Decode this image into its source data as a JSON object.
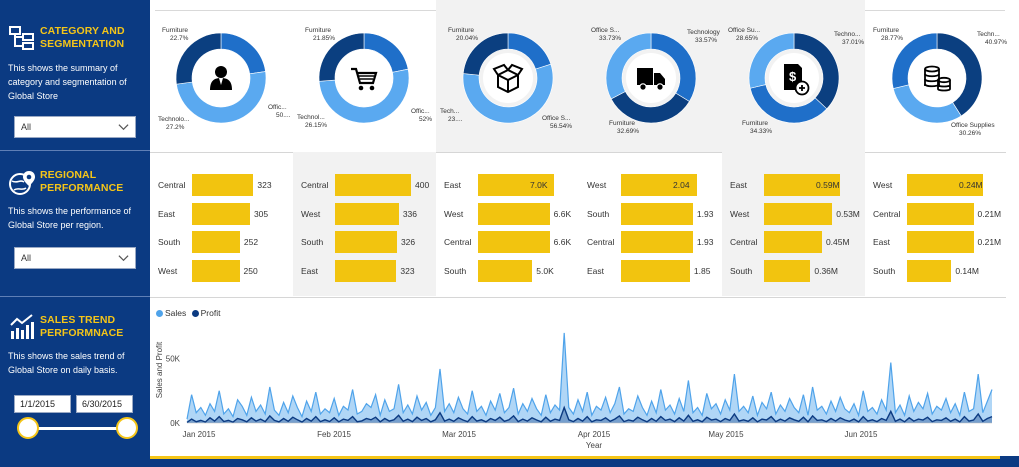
{
  "sidebar": {
    "category": {
      "title_line1": "CATEGORY AND",
      "title_line2": "SEGMENTATION",
      "desc": "This shows the summary of category and segmentation of Global Store",
      "dropdown": "All"
    },
    "regional": {
      "title_line1": "REGIONAL",
      "title_line2": "PERFORMANCE",
      "desc": "This shows the performance of Global Store per region.",
      "dropdown": "All"
    },
    "trend": {
      "title_line1": "SALES TREND",
      "title_line2": "PERFORMNACE",
      "desc": "This shows the sales trend of Global Store on daily basis.",
      "date_start": "1/1/2015",
      "date_end": "6/30/2015"
    }
  },
  "colors": {
    "navy": "#0b3a82",
    "gold": "#f5c518",
    "bar": "#f2c40f",
    "donut_light": "#5aa9f0",
    "donut_mid": "#1f6fc9",
    "donut_dark": "#0b3f80",
    "sales": "#4fa3ea",
    "profit": "#0b3a82"
  },
  "donuts": [
    {
      "icon": "person-icon",
      "segments": [
        {
          "label": "Furniture",
          "pct": "22.7%",
          "value": 22.7,
          "color": "#1f6fc9"
        },
        {
          "label": "Offic...",
          "pct": "50....",
          "value": 50.1,
          "color": "#5aa9f0"
        },
        {
          "label": "Technolo...",
          "pct": "27.2%",
          "value": 27.2,
          "color": "#0b3f80"
        }
      ]
    },
    {
      "icon": "cart-icon",
      "segments": [
        {
          "label": "Furniture",
          "pct": "21.85%",
          "value": 21.85,
          "color": "#1f6fc9"
        },
        {
          "label": "Offic...",
          "pct": "52%",
          "value": 52.0,
          "color": "#5aa9f0"
        },
        {
          "label": "Technol...",
          "pct": "26.15%",
          "value": 26.15,
          "color": "#0b3f80"
        }
      ]
    },
    {
      "icon": "box-icon",
      "segments": [
        {
          "label": "Furniture",
          "pct": "20.04%",
          "value": 20.04,
          "color": "#1f6fc9"
        },
        {
          "label": "Office S...",
          "pct": "56.54%",
          "value": 56.54,
          "color": "#5aa9f0"
        },
        {
          "label": "Tech...",
          "pct": "23....",
          "value": 23.42,
          "color": "#0b3f80"
        }
      ]
    },
    {
      "icon": "truck-icon",
      "segments": [
        {
          "label": "Office S...",
          "pct": "33.73%",
          "value": 33.73,
          "color": "#1f6fc9"
        },
        {
          "label": "Technology",
          "pct": "33.57%",
          "value": 33.57,
          "color": "#0b3f80"
        },
        {
          "label": "Furniture",
          "pct": "32.69%",
          "value": 32.69,
          "color": "#5aa9f0"
        }
      ]
    },
    {
      "icon": "money-document-icon",
      "segments": [
        {
          "label": "Techno...",
          "pct": "37.01%",
          "value": 37.01,
          "color": "#0b3f80"
        },
        {
          "label": "Furniture",
          "pct": "34.33%",
          "value": 34.33,
          "color": "#1f6fc9"
        },
        {
          "label": "Office Su...",
          "pct": "28.65%",
          "value": 28.65,
          "color": "#5aa9f0"
        }
      ]
    },
    {
      "icon": "coins-icon",
      "segments": [
        {
          "label": "Techn...",
          "pct": "40.97%",
          "value": 40.97,
          "color": "#0b3f80"
        },
        {
          "label": "Office Supplies",
          "pct": "30.26%",
          "value": 30.26,
          "color": "#5aa9f0"
        },
        {
          "label": "Furniture",
          "pct": "28.77%",
          "value": 28.77,
          "color": "#1f6fc9"
        }
      ]
    }
  ],
  "regional_bars": [
    {
      "max": 400,
      "rows": [
        {
          "region": "Central",
          "value": 323,
          "label": "323"
        },
        {
          "region": "East",
          "value": 305,
          "label": "305"
        },
        {
          "region": "South",
          "value": 252,
          "label": "252"
        },
        {
          "region": "West",
          "value": 250,
          "label": "250"
        }
      ]
    },
    {
      "max": 400,
      "rows": [
        {
          "region": "Central",
          "value": 400,
          "label": "400"
        },
        {
          "region": "West",
          "value": 336,
          "label": "336"
        },
        {
          "region": "South",
          "value": 326,
          "label": "326"
        },
        {
          "region": "East",
          "value": 323,
          "label": "323"
        }
      ]
    },
    {
      "max": 7.0,
      "rows": [
        {
          "region": "East",
          "value": 7.0,
          "label": "7.0K"
        },
        {
          "region": "West",
          "value": 6.6,
          "label": "6.6K"
        },
        {
          "region": "Central",
          "value": 6.6,
          "label": "6.6K"
        },
        {
          "region": "South",
          "value": 5.0,
          "label": "5.0K"
        }
      ]
    },
    {
      "max": 2.04,
      "rows": [
        {
          "region": "West",
          "value": 2.04,
          "label": "2.04"
        },
        {
          "region": "South",
          "value": 1.93,
          "label": "1.93"
        },
        {
          "region": "Central",
          "value": 1.93,
          "label": "1.93"
        },
        {
          "region": "East",
          "value": 1.85,
          "label": "1.85"
        }
      ]
    },
    {
      "max": 0.59,
      "rows": [
        {
          "region": "East",
          "value": 0.59,
          "label": "0.59M"
        },
        {
          "region": "West",
          "value": 0.53,
          "label": "0.53M"
        },
        {
          "region": "Central",
          "value": 0.45,
          "label": "0.45M"
        },
        {
          "region": "South",
          "value": 0.36,
          "label": "0.36M"
        }
      ]
    },
    {
      "max": 0.24,
      "rows": [
        {
          "region": "West",
          "value": 0.24,
          "label": "0.24M"
        },
        {
          "region": "Central",
          "value": 0.21,
          "label": "0.21M"
        },
        {
          "region": "East",
          "value": 0.21,
          "label": "0.21M"
        },
        {
          "region": "South",
          "value": 0.14,
          "label": "0.14M"
        }
      ]
    }
  ],
  "chart_data": {
    "type": "area",
    "legend": [
      "Sales",
      "Profit"
    ],
    "xlabel": "Year",
    "ylabel": "Sales and Profit",
    "y_ticks": [
      "50K",
      "0K"
    ],
    "ylim": [
      0,
      80000
    ],
    "x_ticks": [
      "Jan 2015",
      "Feb 2015",
      "Mar 2015",
      "Apr 2015",
      "May 2015",
      "Jun 2015"
    ],
    "series": [
      {
        "name": "Sales",
        "values": [
          3000,
          22000,
          8000,
          12000,
          6000,
          15000,
          9000,
          25000,
          7000,
          11000,
          5000,
          18000,
          13000,
          6000,
          20000,
          9000,
          14000,
          7000,
          28000,
          10000,
          6000,
          16000,
          8000,
          21000,
          12000,
          5000,
          17000,
          9000,
          24000,
          7000,
          11000,
          8000,
          19000,
          6000,
          13000,
          10000,
          26000,
          7000,
          9000,
          15000,
          12000,
          22000,
          6000,
          18000,
          9000,
          11000,
          30000,
          8000,
          14000,
          7000,
          21000,
          10000,
          16000,
          6000,
          12000,
          42000,
          9000,
          15000,
          8000,
          20000,
          11000,
          7000,
          25000,
          9000,
          13000,
          6000,
          17000,
          10000,
          23000,
          8000,
          12000,
          27000,
          7000,
          15000,
          9000,
          19000,
          11000,
          6000,
          22000,
          8000,
          14000,
          10000,
          70000,
          12000,
          7000,
          18000,
          9000,
          24000,
          6000,
          13000,
          10000,
          20000,
          8000,
          15000,
          28000,
          7000,
          11000,
          9000,
          21000,
          12000,
          6000,
          17000,
          8000,
          26000,
          10000,
          14000,
          7000,
          19000,
          9000,
          33000,
          8000,
          12000,
          6000,
          23000,
          11000,
          15000,
          7000,
          18000,
          10000,
          38000,
          9000,
          13000,
          8000,
          21000,
          6000,
          16000,
          11000,
          24000,
          7000,
          14000,
          9000,
          19000,
          12000,
          8000,
          22000,
          6000,
          28000,
          10000,
          13000,
          7000,
          17000,
          9000,
          20000,
          11000,
          8000,
          15000,
          6000,
          25000,
          9000,
          12000,
          7000,
          18000,
          10000,
          47000,
          8000,
          14000,
          6000,
          21000,
          9000,
          16000,
          11000,
          23000,
          7000,
          13000,
          10000,
          19000,
          8000,
          15000,
          6000,
          24000,
          9000,
          11000,
          38000,
          8000,
          17000,
          26000
        ]
      },
      {
        "name": "Profit",
        "values": [
          500,
          3000,
          1000,
          2000,
          800,
          4000,
          1500,
          5000,
          1200,
          2000,
          700,
          3500,
          2500,
          900,
          4000,
          1500,
          3000,
          1100,
          5500,
          2000,
          900,
          3500,
          1300,
          4500,
          2500,
          800,
          3500,
          1500,
          5000,
          1100,
          2500,
          1200,
          4000,
          900,
          3000,
          2000,
          5000,
          1000,
          1600,
          3500,
          2500,
          4500,
          900,
          3500,
          1500,
          2500,
          6000,
          1300,
          3000,
          1100,
          4500,
          2000,
          3500,
          900,
          2500,
          8000,
          1500,
          3000,
          1300,
          4000,
          2300,
          1000,
          5000,
          1500,
          2500,
          900,
          3500,
          2000,
          4500,
          1300,
          2500,
          5500,
          1100,
          3000,
          1500,
          4000,
          2300,
          900,
          4500,
          1300,
          3000,
          2000,
          12000,
          2500,
          1100,
          3500,
          1500,
          5000,
          900,
          2500,
          2000,
          4000,
          1300,
          3000,
          5500,
          1100,
          2300,
          1500,
          4500,
          2500,
          900,
          3500,
          1300,
          5000,
          2000,
          3000,
          1100,
          4000,
          1500,
          6000,
          1300,
          2500,
          900,
          4500,
          2300,
          3000,
          1100,
          3500,
          2000,
          7000,
          1500,
          2500,
          1300,
          4000,
          900,
          3000,
          2300,
          5000,
          1100,
          3000,
          1500,
          4000,
          2500,
          1300,
          4500,
          900,
          5500,
          2000,
          2500,
          1100,
          3500,
          1500,
          4000,
          2300,
          1300,
          3000,
          900,
          5000,
          1500,
          2500,
          1100,
          3500,
          2000,
          9000,
          1300,
          3000,
          900,
          4000,
          1500,
          3000,
          2300,
          4500,
          1100,
          2500,
          2000,
          4000,
          1300,
          3000,
          900,
          5000,
          1500,
          2300,
          7000,
          1300,
          3500,
          5000
        ]
      }
    ]
  }
}
